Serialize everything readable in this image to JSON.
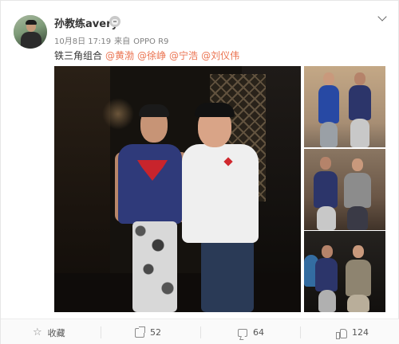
{
  "post": {
    "author": "孙教练avery",
    "date": "10月8日 17:19",
    "source_prefix": "来自",
    "source": "OPPO R9",
    "text": "铁三角组合",
    "mentions": [
      "@黄渤",
      "@徐峥",
      "@宁浩",
      "@刘仪伟"
    ]
  },
  "images": {
    "main_alt": "two men posing in a dark room, one in a superman t-shirt, one in a white t-shirt and black cap",
    "thumbnails": [
      "photo-2",
      "photo-3",
      "photo-4"
    ]
  },
  "actions": {
    "favorite_label": "收藏",
    "share_count": "52",
    "comment_count": "64",
    "like_count": "124"
  }
}
